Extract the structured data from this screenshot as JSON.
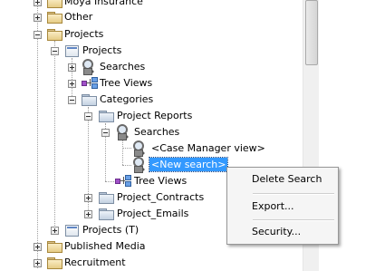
{
  "tree": {
    "nodes": {
      "moya": "Moya Insurance",
      "other": "Other",
      "projects_root": "Projects",
      "projects_proj": "Projects",
      "searches_1": "Searches",
      "tree_views_1": "Tree Views",
      "categories": "Categories",
      "project_reports": "Project Reports",
      "searches_2": "Searches",
      "case_manager_view": "<Case Manager view>",
      "new_search": "<New search>",
      "tree_views_2": "Tree Views",
      "project_contracts": "Project_Contracts",
      "project_emails": "Project_Emails",
      "projects_t": "Projects (T)",
      "published_media": "Published Media",
      "recruitment": "Recruitment"
    },
    "selected": "new_search"
  },
  "context_menu": {
    "items": {
      "delete_search": "Delete Search",
      "export": "Export...",
      "security": "Security..."
    }
  },
  "colors": {
    "selection": "#3399ff",
    "folder": "#e6cc86",
    "menu_background": "#f5f5f5"
  },
  "icons": {
    "folder": "folder-icon",
    "project": "project-icon",
    "search": "search-icon",
    "tree_view": "tree-view-icon"
  }
}
